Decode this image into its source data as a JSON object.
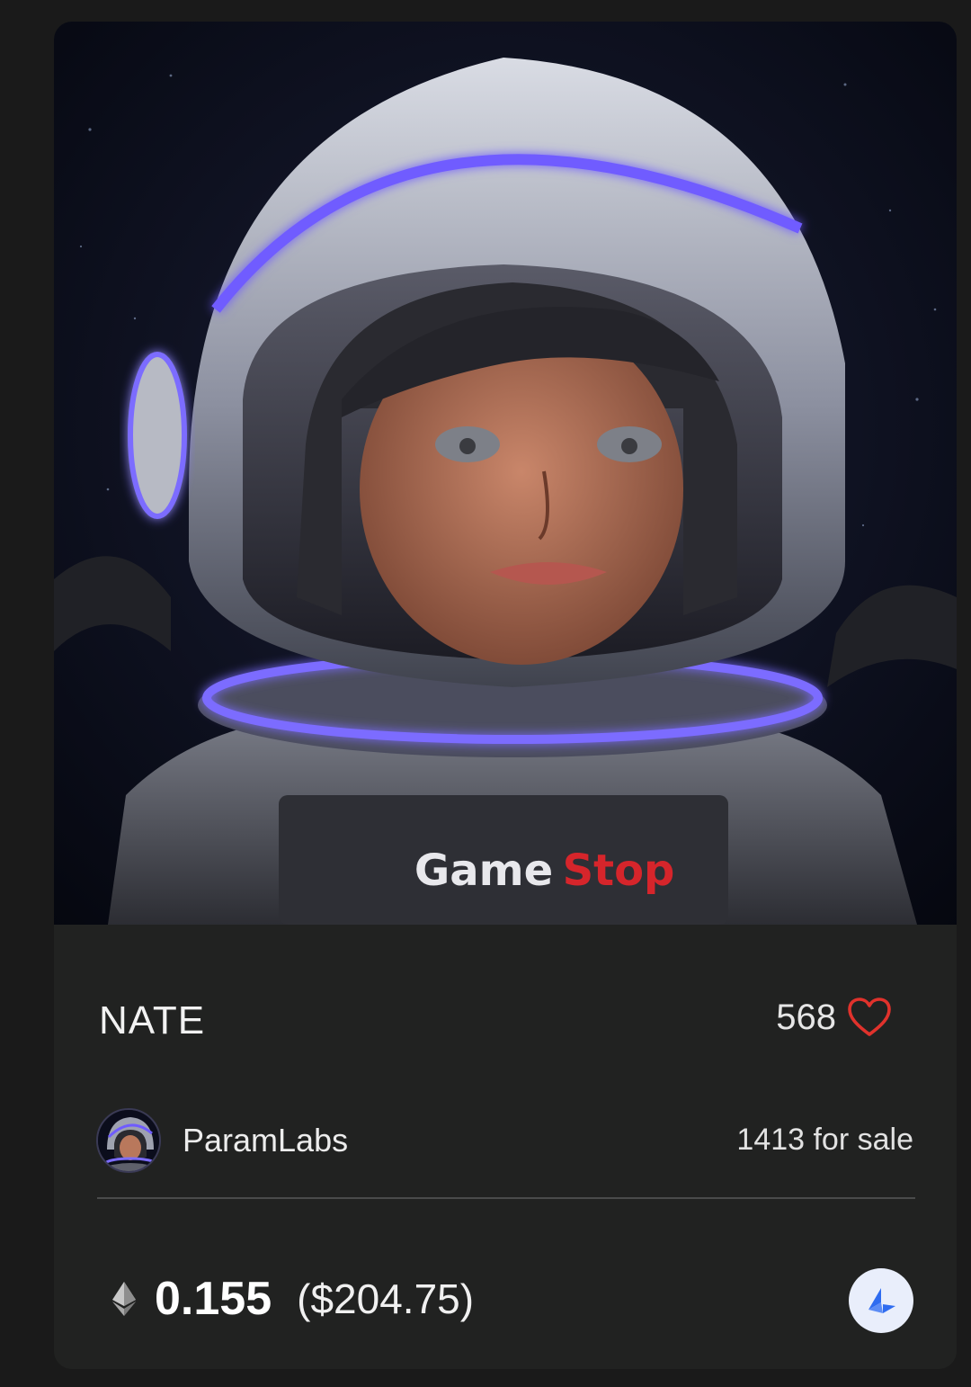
{
  "nft": {
    "title": "NATE",
    "likes": "568",
    "creator": "ParamLabs",
    "for_sale": "1413 for sale",
    "price_eth": "0.155",
    "price_usd": "($204.75)",
    "artwork_label": "GameStop"
  },
  "icons": {
    "like": "heart-icon",
    "currency": "eth-icon",
    "chain": "loopring-icon"
  },
  "colors": {
    "heart": "#e0322c",
    "chain_icon": "#2f6cf0",
    "card_bg": "#212221",
    "page_bg": "#1a1a1a"
  }
}
